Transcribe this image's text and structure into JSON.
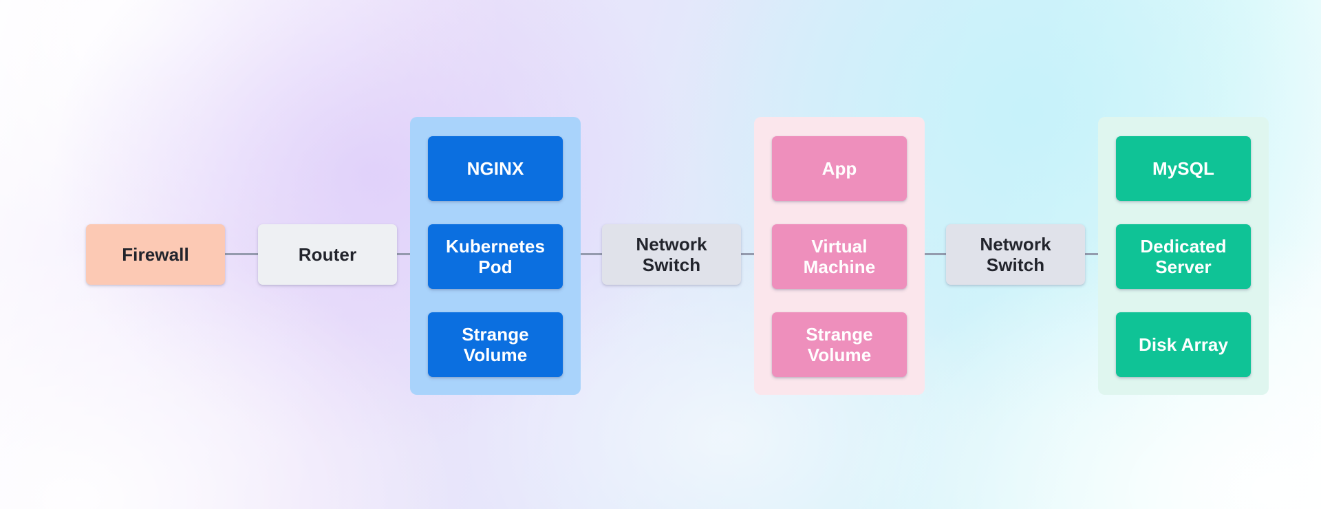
{
  "diagram": {
    "type": "network-infrastructure-flow",
    "orientation": "left-to-right",
    "background": {
      "style": "soft pastel gradient",
      "colors": [
        "#fdfcff",
        "#ece3fa",
        "#dcecfa",
        "#d5f3fa",
        "#fbfeff"
      ]
    },
    "connector": {
      "color": "#8f96a9",
      "style": "straight-horizontal"
    },
    "nodes": [
      {
        "id": "firewall",
        "label": "Firewall",
        "kind": "single",
        "fill": "#fcc9b4",
        "text_color": "#22242c"
      },
      {
        "id": "router",
        "label": "Router",
        "kind": "single",
        "fill": "#eef0f3",
        "text_color": "#22242c"
      },
      {
        "id": "compute-group",
        "kind": "group",
        "fill": "#a9d3fb",
        "child_fill": "#0b6fe0",
        "child_text_color": "#ffffff",
        "children": [
          {
            "id": "nginx",
            "label": "NGINX"
          },
          {
            "id": "kubernetes-pod",
            "label": "Kubernetes\nPod"
          },
          {
            "id": "strange-volume-blue",
            "label": "Strange\nVolume"
          }
        ]
      },
      {
        "id": "network-switch-1",
        "label": "Network\nSwitch",
        "kind": "single",
        "fill": "#e0e2ea",
        "text_color": "#22242c"
      },
      {
        "id": "virtualization-group",
        "kind": "group",
        "fill": "#fbe6ec",
        "child_fill": "#ee8fbc",
        "child_text_color": "#ffffff",
        "children": [
          {
            "id": "app",
            "label": "App"
          },
          {
            "id": "virtual-machine",
            "label": "Virtual\nMachine"
          },
          {
            "id": "strange-volume-pink",
            "label": "Strange\nVolume"
          }
        ]
      },
      {
        "id": "network-switch-2",
        "label": "Network\nSwitch",
        "kind": "single",
        "fill": "#e0e2ea",
        "text_color": "#22242c"
      },
      {
        "id": "storage-group",
        "kind": "group",
        "fill": "#dff6ef",
        "child_fill": "#0fc396",
        "child_text_color": "#ffffff",
        "children": [
          {
            "id": "mysql",
            "label": "MySQL"
          },
          {
            "id": "dedicated-server",
            "label": "Dedicated\nServer"
          },
          {
            "id": "disk-array",
            "label": "Disk Array"
          }
        ]
      }
    ]
  }
}
